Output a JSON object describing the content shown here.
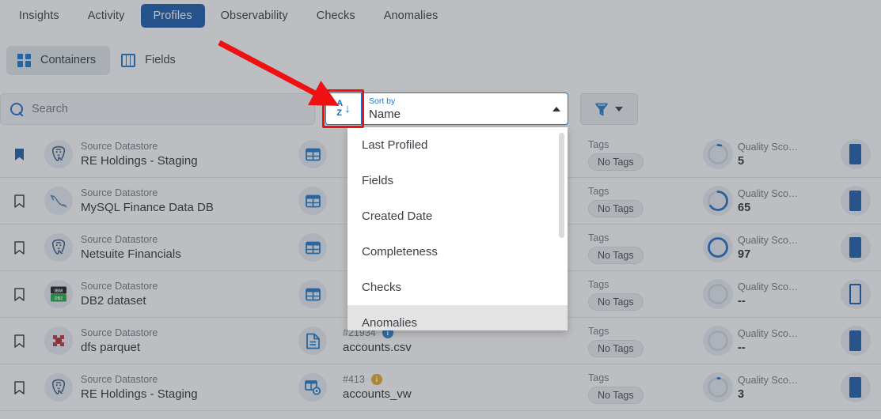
{
  "topnav": {
    "tabs": [
      {
        "label": "Insights",
        "active": false
      },
      {
        "label": "Activity",
        "active": false
      },
      {
        "label": "Profiles",
        "active": true
      },
      {
        "label": "Observability",
        "active": false
      },
      {
        "label": "Checks",
        "active": false
      },
      {
        "label": "Anomalies",
        "active": false
      }
    ]
  },
  "subnav": {
    "segments": [
      {
        "label": "Containers",
        "icon": "grid-2x2-icon",
        "active": true
      },
      {
        "label": "Fields",
        "icon": "columns-icon",
        "active": false
      }
    ]
  },
  "toolbar": {
    "search_placeholder": "Search",
    "search_value": "",
    "search_icon": "search-icon",
    "sort_icon": "sort-alpha-descending-icon",
    "sort_label": "Sort by",
    "sort_value": "Name",
    "sort_caret": "caret-up-icon",
    "filter_icon": "funnel-icon",
    "filter_caret": "caret-down-icon"
  },
  "sort_menu": {
    "options": [
      {
        "label": "Anomalies",
        "highlighted": true
      },
      {
        "label": "Checks",
        "highlighted": false
      },
      {
        "label": "Completeness",
        "highlighted": false
      },
      {
        "label": "Created Date",
        "highlighted": false
      },
      {
        "label": "Fields",
        "highlighted": false
      },
      {
        "label": "Last Profiled",
        "highlighted": false
      }
    ]
  },
  "colors": {
    "accent_blue": "#0e52a8",
    "icon_blue": "#0e6ec4",
    "annotation_red": "#ee1111",
    "info_blue": "#1f7ed0",
    "info_amber": "#e8a317"
  },
  "list": {
    "labels": {
      "datastore_kicker": "Source Datastore",
      "tags_kicker": "Tags",
      "quality_kicker": "Quality Sco…"
    },
    "rows": [
      {
        "bookmarked": true,
        "datastore_icon": "postgresql-icon",
        "datastore_kicker": "Source Datastore",
        "datastore_name": "RE Holdings - Staging",
        "container_icon": "table-icon",
        "container_id": "",
        "container_info": "",
        "container_name": "",
        "tags_kicker": "Tags",
        "tags_value": "No Tags",
        "quality_kicker": "Quality Sco…",
        "quality_value": "5",
        "quality_pct": 5,
        "health_icon": "bar-filled-icon"
      },
      {
        "bookmarked": false,
        "datastore_icon": "mysql-icon",
        "datastore_kicker": "Source Datastore",
        "datastore_name": "MySQL Finance Data DB",
        "container_icon": "table-icon",
        "container_id": "",
        "container_info": "",
        "container_name": "",
        "tags_kicker": "Tags",
        "tags_value": "No Tags",
        "quality_kicker": "Quality Sco…",
        "quality_value": "65",
        "quality_pct": 65,
        "health_icon": "bar-filled-icon"
      },
      {
        "bookmarked": false,
        "datastore_icon": "postgresql-icon",
        "datastore_kicker": "Source Datastore",
        "datastore_name": "Netsuite Financials",
        "container_icon": "table-icon",
        "container_id": "",
        "container_info": "",
        "container_name": "",
        "tags_kicker": "Tags",
        "tags_value": "No Tags",
        "quality_kicker": "Quality Sco…",
        "quality_value": "97",
        "quality_pct": 97,
        "health_icon": "bar-filled-icon"
      },
      {
        "bookmarked": false,
        "datastore_icon": "db2-icon",
        "datastore_kicker": "Source Datastore",
        "datastore_name": "DB2 dataset",
        "container_icon": "table-icon",
        "container_id": "",
        "container_info": "",
        "container_name": "",
        "tags_kicker": "Tags",
        "tags_value": "No Tags",
        "quality_kicker": "Quality Sco…",
        "quality_value": "--",
        "quality_pct": 0,
        "health_icon": "bar-outline-icon"
      },
      {
        "bookmarked": false,
        "datastore_icon": "drill-icon",
        "datastore_kicker": "Source Datastore",
        "datastore_name": "dfs parquet",
        "container_icon": "file-icon",
        "container_id": "#21934",
        "container_info": "info-blue-icon",
        "container_name": "accounts.csv",
        "tags_kicker": "Tags",
        "tags_value": "No Tags",
        "quality_kicker": "Quality Sco…",
        "quality_value": "--",
        "quality_pct": 0,
        "health_icon": "bar-filled-icon"
      },
      {
        "bookmarked": false,
        "datastore_icon": "postgresql-icon",
        "datastore_kicker": "Source Datastore",
        "datastore_name": "RE Holdings - Staging",
        "container_icon": "view-icon",
        "container_id": "#413",
        "container_info": "info-amber-icon",
        "container_name": "accounts_vw",
        "tags_kicker": "Tags",
        "tags_value": "No Tags",
        "quality_kicker": "Quality Sco…",
        "quality_value": "3",
        "quality_pct": 3,
        "health_icon": "bar-filled-icon"
      }
    ]
  }
}
